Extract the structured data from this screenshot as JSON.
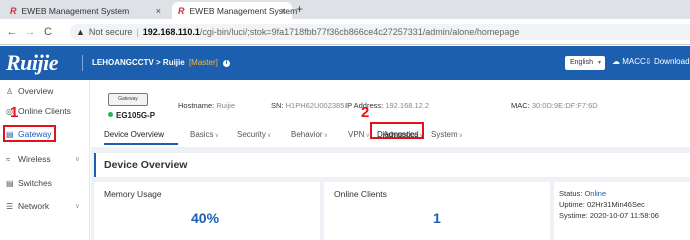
{
  "browser": {
    "tabs": [
      {
        "title": "EWEB Management System",
        "active": false
      },
      {
        "title": "EWEB Management System",
        "active": true
      }
    ],
    "new_tab": "+",
    "close_glyph": "×",
    "nav": {
      "back": "←",
      "forward": "→",
      "reload": "C"
    },
    "url": {
      "warning_icon": "▲",
      "security": "Not secure",
      "separator": "|",
      "host": "192.168.110.1",
      "path": "/cgi-bin/luci/;stok=9fa1718fbb77f36cb866ce4c27257331/admin/alone/homepage"
    }
  },
  "header": {
    "brand": "Ruijie",
    "device_name": "LEHOANGCCTV",
    "separator": ">",
    "device": "Ruijie",
    "role": "[Master]",
    "language": "English",
    "macc": "MACC",
    "download": "Download"
  },
  "sidebar": {
    "items": [
      {
        "label": "Overview",
        "icon": "overview-icon",
        "glyph": "♙",
        "arrow": false,
        "active": false
      },
      {
        "label": "Online Clients",
        "icon": "clients-icon",
        "glyph": "◎",
        "arrow": false,
        "active": false
      },
      {
        "label": "Gateway",
        "icon": "gateway-icon",
        "glyph": "▤",
        "arrow": false,
        "active": true
      },
      {
        "label": "Wireless",
        "icon": "wireless-icon",
        "glyph": "≈",
        "arrow": true,
        "active": false
      },
      {
        "label": "Switches",
        "icon": "switch-icon",
        "glyph": "▤",
        "arrow": false,
        "active": false
      },
      {
        "label": "Network",
        "icon": "network-icon",
        "glyph": "☰",
        "arrow": true,
        "active": false
      }
    ],
    "arrow_glyph": "∨"
  },
  "annotations": {
    "step1": "1",
    "step2": "2",
    "highlight_color": "#e1121c"
  },
  "device": {
    "image_label": "Gateway",
    "model": "EG105G-P",
    "status_color": "#2bb24c",
    "hostname_label": "Hostname:",
    "hostname": "Ruijie",
    "sn_label": "SN:",
    "sn": "H1PH62U002385",
    "ip_label": "IP Address:",
    "ip": "192.168.12.2",
    "mac_label": "MAC:",
    "mac": "30:0D:9E:DF:F7:6D"
  },
  "main_tabs": [
    {
      "label": "Device Overview",
      "caret": false
    },
    {
      "label": "Basics",
      "caret": true
    },
    {
      "label": "Security",
      "caret": true
    },
    {
      "label": "Behavior",
      "caret": true
    },
    {
      "label": "VPN",
      "caret": true
    },
    {
      "label": "Advanced",
      "caret": true
    },
    {
      "label": "Diagnostics",
      "caret": true
    },
    {
      "label": "System",
      "caret": true
    }
  ],
  "overview": {
    "title": "Device Overview",
    "memory_label": "Memory Usage",
    "memory_value": "40%",
    "clients_label": "Online Clients",
    "clients_value": "1",
    "status_label": "Status:",
    "status_value": "Online",
    "uptime_label": "Uptime:",
    "uptime_value": "02Hr31Min46Sec",
    "systime_label": "Systime:",
    "systime_value": "2020-10-07 11:58:06"
  },
  "colors": {
    "brand_blue": "#1c5fae",
    "accent_red": "#d7263d",
    "master_orange": "#f7b733"
  }
}
